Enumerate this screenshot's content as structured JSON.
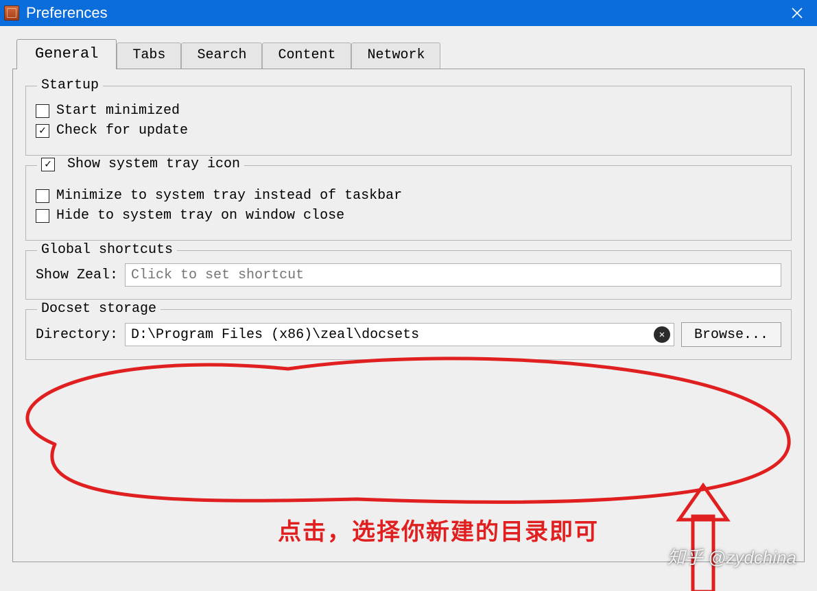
{
  "titlebar": {
    "title": "Preferences"
  },
  "tabs": {
    "active": "General",
    "items": [
      "General",
      "Tabs",
      "Search",
      "Content",
      "Network"
    ]
  },
  "startup": {
    "legend": "Startup",
    "start_minimized": {
      "label": "Start minimized",
      "checked": false
    },
    "check_update": {
      "label": "Check for update",
      "checked": true
    }
  },
  "systray": {
    "show_tray": {
      "label": "Show system tray icon",
      "checked": true
    },
    "minimize_tray": {
      "label": "Minimize to system tray instead of taskbar",
      "checked": false
    },
    "hide_on_close": {
      "label": "Hide to system tray on window close",
      "checked": false
    }
  },
  "shortcuts": {
    "legend": "Global shortcuts",
    "show_zeal_label": "Show Zeal:",
    "show_zeal_placeholder": "Click to set shortcut"
  },
  "docset": {
    "legend": "Docset storage",
    "directory_label": "Directory:",
    "directory_value": "D:\\Program Files (x86)\\zeal\\docsets",
    "browse_label": "Browse..."
  },
  "annotation": {
    "text": "点击，选择你新建的目录即可"
  },
  "watermark": {
    "text": "知乎 @zydchina"
  }
}
